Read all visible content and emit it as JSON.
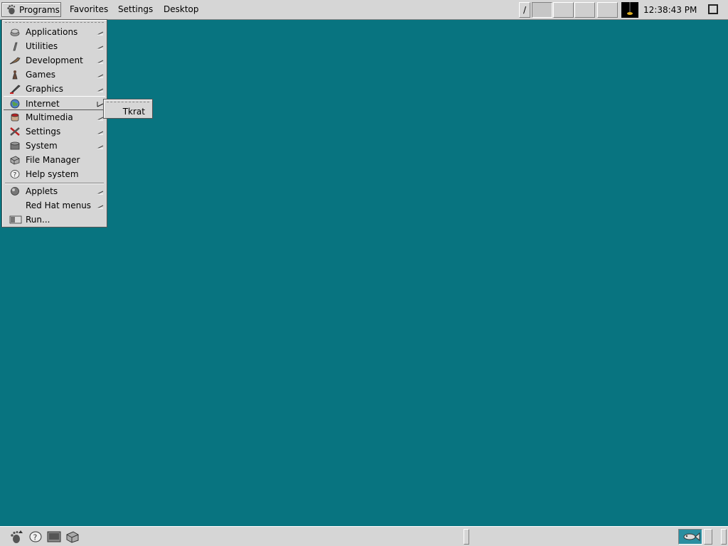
{
  "top_panel": {
    "menubar": {
      "programs": "Programs",
      "favorites": "Favorites",
      "settings": "Settings",
      "desktop": "Desktop"
    },
    "pager_handle_glyph": "/",
    "clock": "12:38:43 PM"
  },
  "programs_menu": {
    "items": [
      {
        "label": "Applications",
        "icon": "applications-icon",
        "submenu": true
      },
      {
        "label": "Utilities",
        "icon": "utilities-icon",
        "submenu": true
      },
      {
        "label": "Development",
        "icon": "development-icon",
        "submenu": true
      },
      {
        "label": "Games",
        "icon": "games-icon",
        "submenu": true
      },
      {
        "label": "Graphics",
        "icon": "graphics-icon",
        "submenu": true
      },
      {
        "label": "Internet",
        "icon": "internet-globe-icon",
        "submenu": true,
        "active": true
      },
      {
        "label": "Multimedia",
        "icon": "multimedia-icon",
        "submenu": true
      },
      {
        "label": "Settings",
        "icon": "settings-tools-icon",
        "submenu": true
      },
      {
        "label": "System",
        "icon": "system-icon",
        "submenu": true
      },
      {
        "label": "File Manager",
        "icon": "file-manager-icon",
        "submenu": false
      },
      {
        "label": "Help system",
        "icon": "help-icon",
        "submenu": false
      },
      {
        "label": "Applets",
        "icon": "applets-icon",
        "submenu": true
      },
      {
        "label": "Red Hat menus",
        "icon": "",
        "submenu": true
      },
      {
        "label": "Run...",
        "icon": "run-icon",
        "submenu": false
      }
    ]
  },
  "internet_submenu": {
    "items": [
      {
        "label": "Tkrat"
      }
    ]
  },
  "bottom_panel": {
    "launchers": [
      "gnome-foot-icon",
      "help-icon",
      "terminal-icon",
      "file-manager-icon"
    ],
    "applets": [
      "fish-applet-icon"
    ]
  },
  "colors": {
    "desktop": "#087480",
    "panel": "#d6d6d6"
  }
}
